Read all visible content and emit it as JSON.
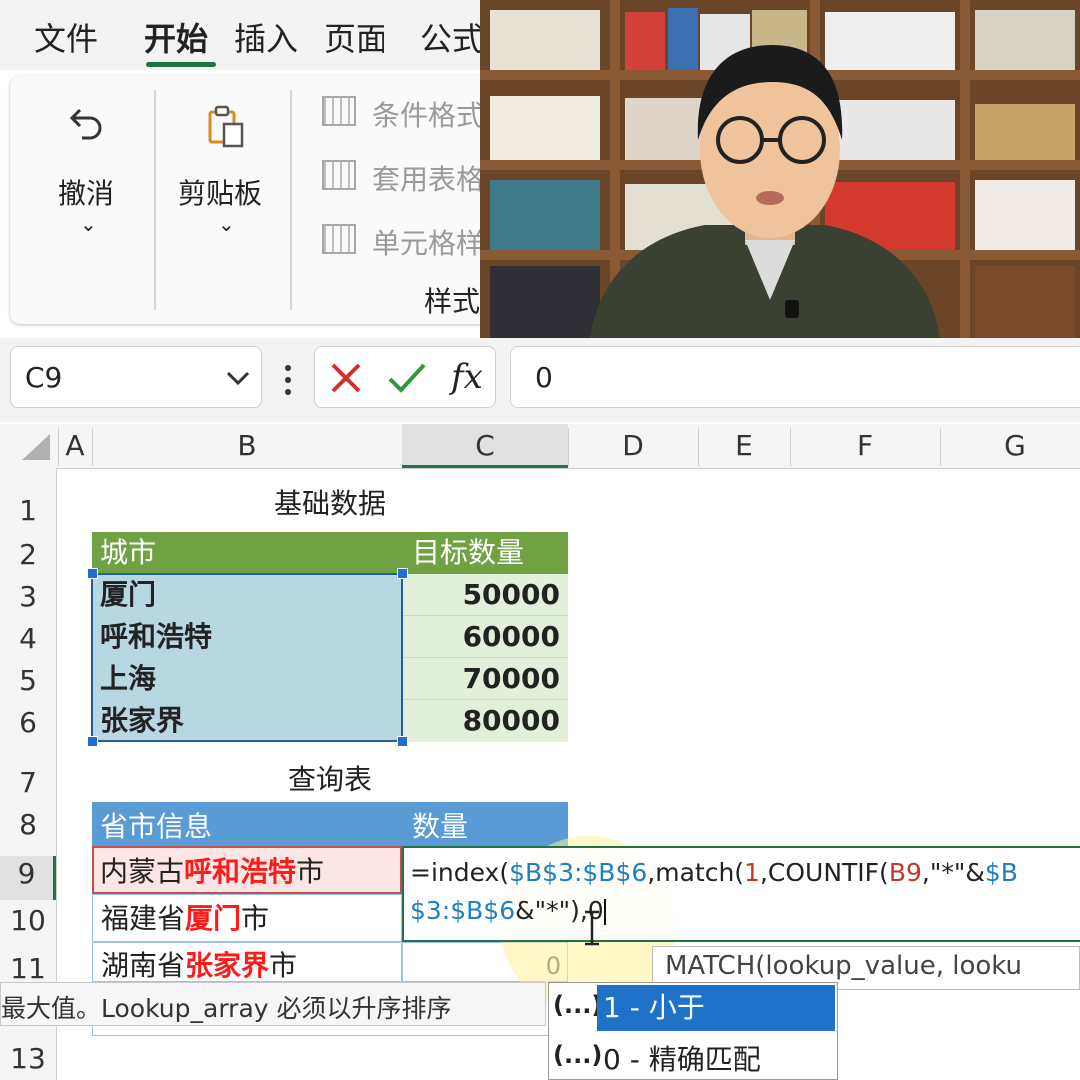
{
  "ribbon": {
    "tabs": [
      "文件",
      "开始",
      "插入",
      "页面布",
      "公式"
    ],
    "undo_label": "撤消",
    "clipboard_label": "剪贴板",
    "styles_items": [
      "条件格式",
      "套用表格",
      "单元格样"
    ],
    "styles_group_label": "样式"
  },
  "formula_bar": {
    "name_box": "C9",
    "value": "0"
  },
  "columns": [
    "A",
    "B",
    "C",
    "D",
    "E",
    "F",
    "G"
  ],
  "rows": [
    "1",
    "2",
    "3",
    "4",
    "5",
    "6",
    "7",
    "8",
    "9",
    "10",
    "11",
    "13"
  ],
  "sheet": {
    "base_title": "基础数据",
    "base_headers": [
      "城市",
      "目标数量"
    ],
    "base_rows": [
      {
        "city": "厦门",
        "qty": "50000"
      },
      {
        "city": "呼和浩特",
        "qty": "60000"
      },
      {
        "city": "上海",
        "qty": "70000"
      },
      {
        "city": "张家界",
        "qty": "80000"
      }
    ],
    "query_title": "查询表",
    "query_headers": [
      "省市信息",
      "数量"
    ],
    "query_rows": [
      {
        "pre": "内蒙古",
        "hi": "呼和浩特",
        "post": "市"
      },
      {
        "pre": "福建省",
        "hi": "厦门",
        "post": "市"
      },
      {
        "pre": "湖南省",
        "hi": "张家界",
        "post": "市"
      }
    ],
    "c11_value": "0"
  },
  "formula_edit": {
    "p1": "=index(",
    "p2": "$B$3:$B$6",
    "p3": ",match(",
    "p4": "1",
    "p5": ",COUNTIF(",
    "p6": "B9",
    "p7": ",\"*\"&",
    "p8": "$B$3:",
    "p9": "$B$6",
    "p10": "&\"*\"),0"
  },
  "tooltip": {
    "signature": "MATCH(lookup_value, looku",
    "hint": "最大值。Lookup_array 必须以升序排序"
  },
  "autocomplete": {
    "items": [
      {
        "prefix": "(...)",
        "label": "1 - 小于",
        "selected": true
      },
      {
        "prefix": "(...)",
        "label": "0 - 精确匹配",
        "selected": false
      }
    ]
  },
  "colors": {
    "green_header": "#70a244",
    "blue_header": "#5b9bd5",
    "red_highlight": "#ff1a1a",
    "teal_fill": "#b7d7e1"
  }
}
